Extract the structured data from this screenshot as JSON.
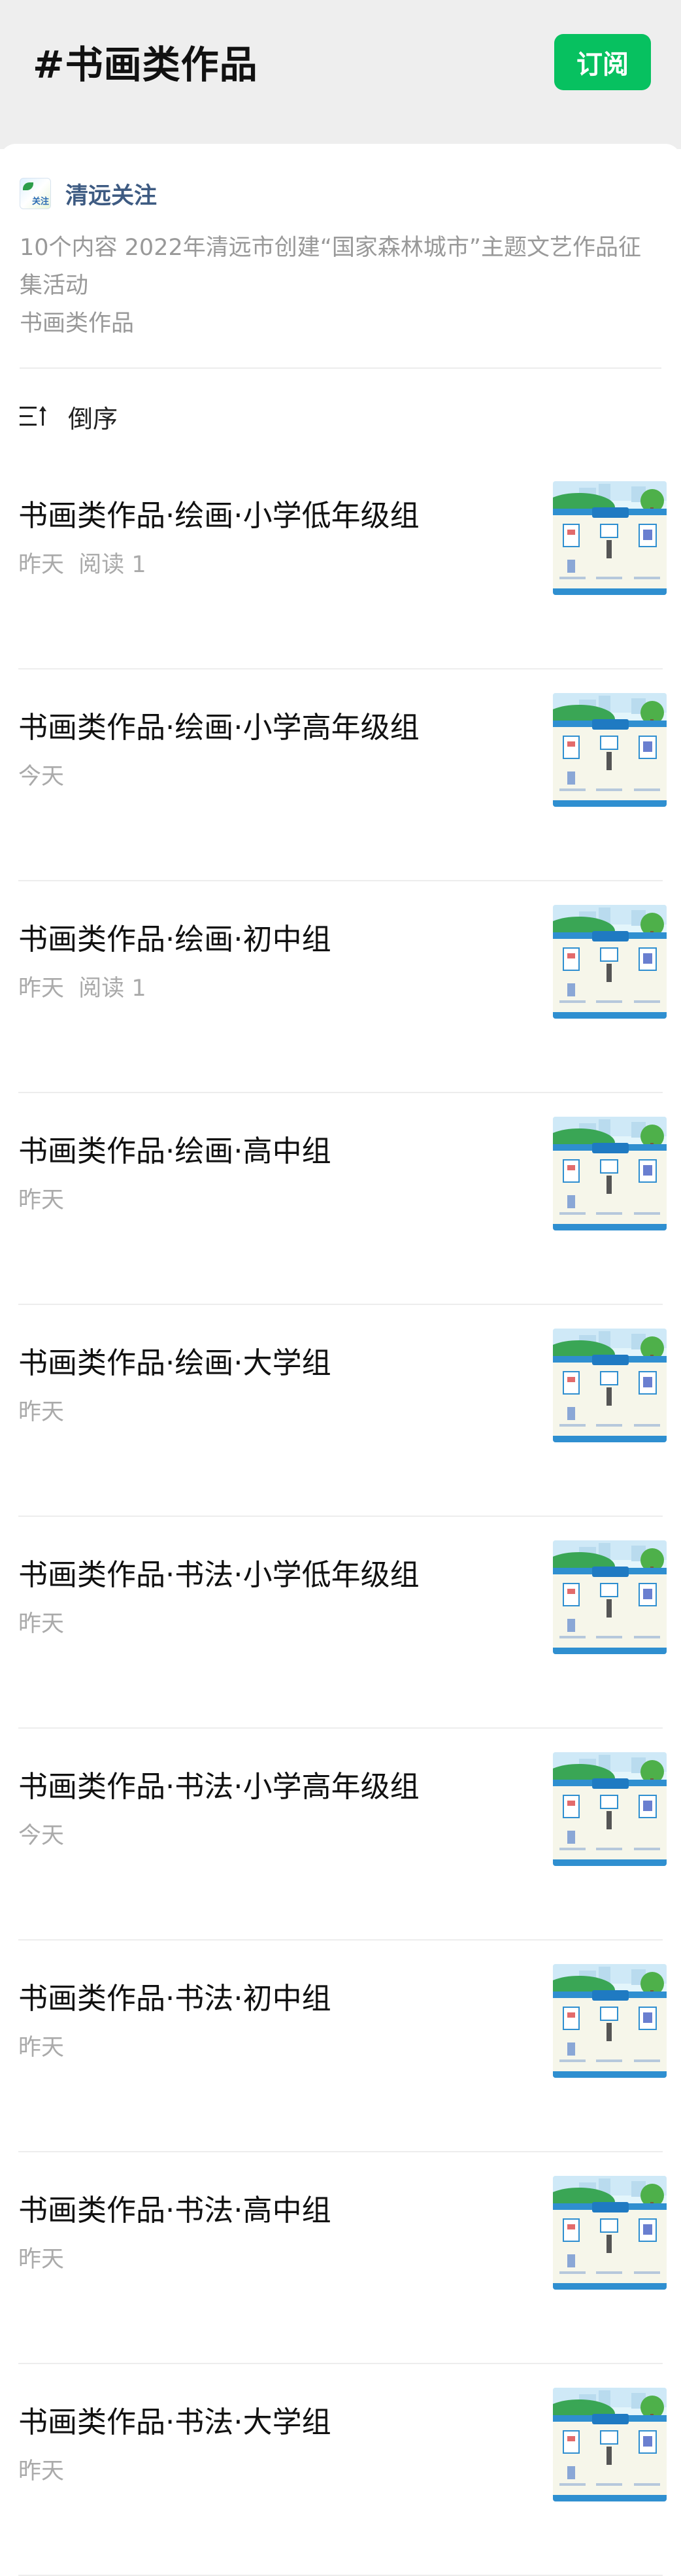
{
  "header": {
    "title": "#书画类作品",
    "subscribe_label": "订阅"
  },
  "album": {
    "account_name": "清远关注",
    "logo_text": "关注",
    "description": "10个内容  2022年清远市创建“国家森林城市”主题文艺作品征集活动",
    "category": "书画类作品",
    "sort_label": "倒序"
  },
  "items": [
    {
      "title": "书画类作品·绘画·小学低年级组",
      "date": "昨天",
      "reads": "阅读 1"
    },
    {
      "title": "书画类作品·绘画·小学高年级组",
      "date": "今天",
      "reads": ""
    },
    {
      "title": "书画类作品·绘画·初中组",
      "date": "昨天",
      "reads": "阅读 1"
    },
    {
      "title": "书画类作品·绘画·高中组",
      "date": "昨天",
      "reads": ""
    },
    {
      "title": "书画类作品·绘画·大学组",
      "date": "昨天",
      "reads": ""
    },
    {
      "title": "书画类作品·书法·小学低年级组",
      "date": "昨天",
      "reads": ""
    },
    {
      "title": "书画类作品·书法·小学高年级组",
      "date": "今天",
      "reads": ""
    },
    {
      "title": "书画类作品·书法·初中组",
      "date": "昨天",
      "reads": ""
    },
    {
      "title": "书画类作品·书法·高中组",
      "date": "昨天",
      "reads": ""
    },
    {
      "title": "书画类作品·书法·大学组",
      "date": "昨天",
      "reads": ""
    }
  ],
  "colors": {
    "accent": "#07c160",
    "account_name": "#3e5b82",
    "meta_text": "#aaaaaa"
  }
}
